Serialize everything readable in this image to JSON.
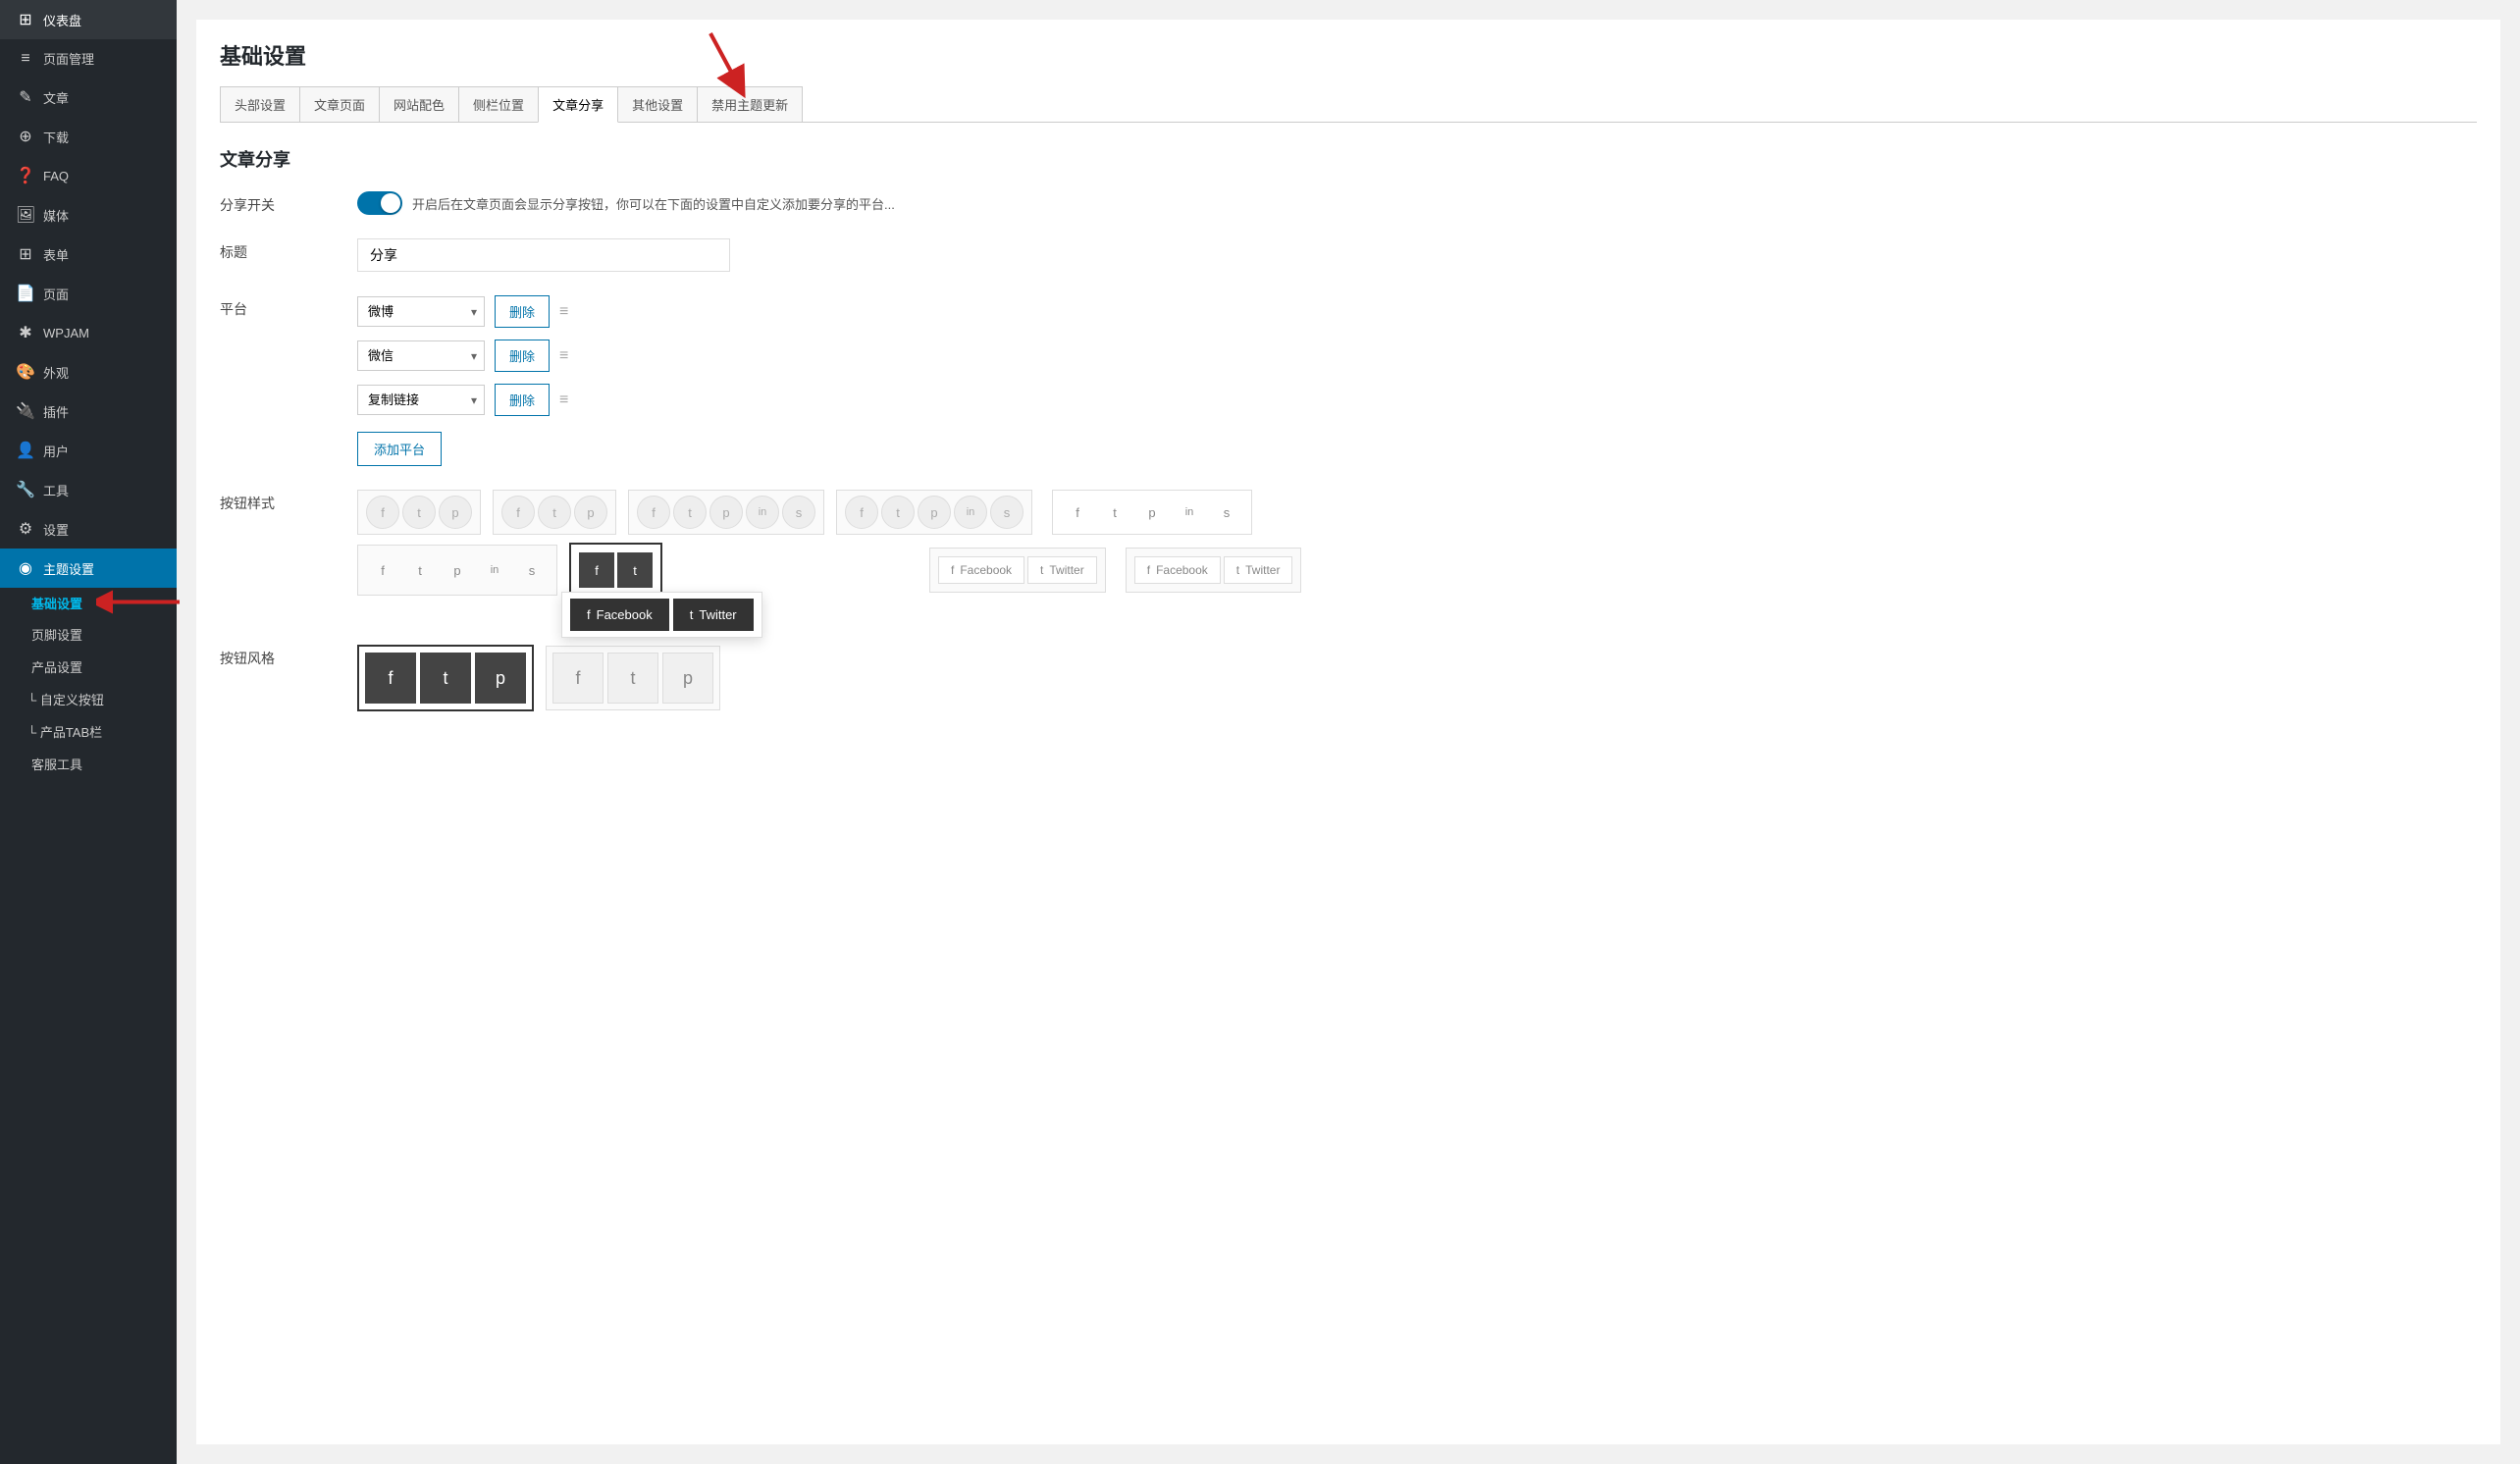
{
  "sidebar": {
    "items": [
      {
        "id": "dashboard",
        "label": "仪表盘",
        "icon": "⊞"
      },
      {
        "id": "page-manage",
        "label": "页面管理",
        "icon": "≡"
      },
      {
        "id": "article",
        "label": "文章",
        "icon": "✎"
      },
      {
        "id": "download",
        "label": "下载",
        "icon": "⊕"
      },
      {
        "id": "faq",
        "label": "FAQ",
        "icon": "?"
      },
      {
        "id": "media",
        "label": "媒体",
        "icon": "⊞"
      },
      {
        "id": "forms",
        "label": "表单",
        "icon": "⊞"
      },
      {
        "id": "pages",
        "label": "页面",
        "icon": "⊞"
      },
      {
        "id": "wpjam",
        "label": "WPJAM",
        "icon": "✱"
      },
      {
        "id": "appearance",
        "label": "外观",
        "icon": "✎"
      },
      {
        "id": "plugins",
        "label": "插件",
        "icon": "⊕"
      },
      {
        "id": "users",
        "label": "用户",
        "icon": "☺"
      },
      {
        "id": "tools",
        "label": "工具",
        "icon": "✱"
      },
      {
        "id": "settings",
        "label": "设置",
        "icon": "⊞"
      },
      {
        "id": "theme-settings",
        "label": "主题设置",
        "icon": "◉",
        "active": true
      },
      {
        "id": "basic-settings",
        "label": "基础设置",
        "icon": "",
        "sub": true,
        "selected": true
      },
      {
        "id": "footer-settings",
        "label": "页脚设置",
        "icon": "",
        "sub": true
      },
      {
        "id": "product-settings",
        "label": "产品设置",
        "icon": "",
        "sub": true
      },
      {
        "id": "custom-button",
        "label": "└ 自定义按钮",
        "icon": "",
        "sub": true,
        "indent": true
      },
      {
        "id": "product-tab",
        "label": "└ 产品TAB栏",
        "icon": "",
        "sub": true,
        "indent": true
      },
      {
        "id": "customer-service",
        "label": "客服工具",
        "icon": "",
        "sub": true
      }
    ]
  },
  "page": {
    "title": "基础设置",
    "tabs": [
      {
        "id": "header",
        "label": "头部设置"
      },
      {
        "id": "article-page",
        "label": "文章页面"
      },
      {
        "id": "site-color",
        "label": "网站配色"
      },
      {
        "id": "sidebar-pos",
        "label": "侧栏位置"
      },
      {
        "id": "article-share",
        "label": "文章分享",
        "active": true
      },
      {
        "id": "other-settings",
        "label": "其他设置"
      },
      {
        "id": "disable-update",
        "label": "禁用主题更新"
      }
    ],
    "section_title": "文章分享"
  },
  "form": {
    "share_toggle_label": "分享开关",
    "share_toggle_text": "开启后在文章页面会显示分享按钮，你可以在下面的设置中自定义添加要分享的平台...",
    "title_label": "标题",
    "title_value": "分享",
    "platform_label": "平台",
    "platforms": [
      {
        "value": "weibo",
        "label": "微博"
      },
      {
        "value": "wechat",
        "label": "微信"
      },
      {
        "value": "copy-link",
        "label": "复制链接"
      }
    ],
    "delete_label": "删除",
    "add_platform_label": "添加平台",
    "btn_style_label": "按钮样式",
    "btn_style_label2": "按钮风格",
    "facebook_label": "Facebook",
    "twitter_label": "Twitter"
  }
}
